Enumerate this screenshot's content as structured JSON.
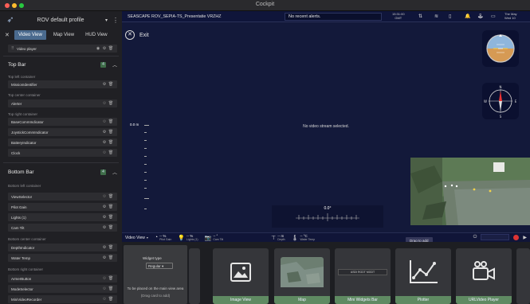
{
  "window": {
    "title": "Cockpit"
  },
  "sidebar": {
    "profile": "ROV default profile",
    "tabs": [
      {
        "label": "Video View",
        "active": true
      },
      {
        "label": "Map View",
        "active": false
      },
      {
        "label": "HUD View",
        "active": false
      }
    ],
    "top_item": "Video player",
    "sections": [
      {
        "title": "Top Bar",
        "badge": "4",
        "containers": [
          {
            "label": "Top left container",
            "items": [
              "MissionIdentifier"
            ]
          },
          {
            "label": "Top center container",
            "items": [
              "Alerter"
            ]
          },
          {
            "label": "Top right container",
            "items": [
              "BaseCommIndicator",
              "JoystickCommIndicator",
              "BatteryIndicator",
              "Clock"
            ]
          }
        ]
      },
      {
        "title": "Bottom Bar",
        "badge": "4",
        "containers": [
          {
            "label": "Bottom left container",
            "items": [
              "ViewSelector",
              "Pilot Gain",
              "Lights (1)",
              "Cam Tilt"
            ]
          },
          {
            "label": "Bottom center container",
            "items": [
              "DepthIndicator",
              "Water Temp"
            ]
          },
          {
            "label": "Bottom right container",
            "items": [
              "ArmerButton",
              "ModeSelector",
              "MiniVideoRecorder"
            ]
          }
        ]
      }
    ]
  },
  "topbar": {
    "mission": "SEASCAPE ROV_SEPIA-TS_Presentatie VRZHZ",
    "alerts": "No recent alerts.",
    "clock_line1": "15:31:00",
    "clock_line2": "GMT",
    "date_line1": "The May",
    "date_line2": "Wed 10"
  },
  "exit": {
    "label": "Exit"
  },
  "video": {
    "message": "No video stream selected."
  },
  "depth_scale": {
    "value": "0.0 m",
    "colors": {
      "tick": "#aaaaaa"
    }
  },
  "heading": {
    "value": "0.0°"
  },
  "statusbar": {
    "view": "Video View",
    "widgets": [
      {
        "icon": "gauge-icon",
        "value": "-- %",
        "name": "Pilot Gain"
      },
      {
        "icon": "lightbulb-icon",
        "value": "-- %",
        "name": "Lights (1)"
      },
      {
        "icon": "camera-icon",
        "value": "-- °",
        "name": "Cam Tilt"
      },
      {
        "icon": "depth-icon",
        "value": "-- m",
        "name": "Depth"
      },
      {
        "icon": "thermometer-icon",
        "value": "-- °C",
        "name": "Water Temp"
      }
    ],
    "drag_tip": "Drag to add"
  },
  "tray": {
    "widget_type_label": "Widget type",
    "widget_type_value": "Regular",
    "hint": "To be placed on the main view area",
    "hint2": "(Drag card to add)",
    "cards": [
      {
        "name": "Image View",
        "icon": "image-icon"
      },
      {
        "name": "Map",
        "icon": "map-thumbnail"
      },
      {
        "name": "Mini Widgets Bar",
        "icon": "mini-widgets-bar",
        "bar_text": "ASDI RGDT MGDT"
      },
      {
        "name": "Plotter",
        "icon": "line-chart-icon"
      },
      {
        "name": "URLVideo Player",
        "icon": "video-camera-icon"
      }
    ]
  },
  "colors": {
    "accent_tab": "#4a6a8e",
    "card_label": "#5f8a62",
    "main_bg": "#13193a"
  }
}
